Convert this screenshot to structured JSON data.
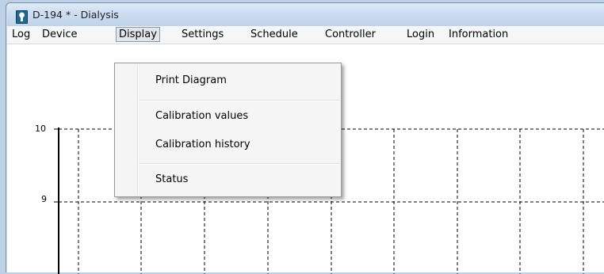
{
  "window": {
    "title": "D-194 * - Dialysis"
  },
  "menubar": {
    "items": [
      {
        "label": "Log"
      },
      {
        "label": "Device"
      },
      {
        "label": "Display"
      },
      {
        "label": "Settings"
      },
      {
        "label": "Schedule"
      },
      {
        "label": "Controller"
      },
      {
        "label": "Login"
      },
      {
        "label": "Information"
      }
    ],
    "active": "Display"
  },
  "display_menu": {
    "items": [
      {
        "label": "Print Diagram"
      },
      {
        "label": "Calibration values"
      },
      {
        "label": "Calibration history"
      },
      {
        "label": "Status"
      }
    ]
  },
  "chart_data": {
    "type": "line",
    "y_ticks": [
      "10",
      "9"
    ],
    "grid": "dashed"
  }
}
